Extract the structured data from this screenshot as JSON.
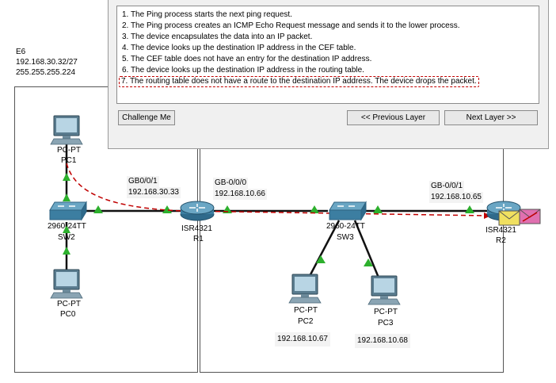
{
  "area_e6": {
    "name": "E6",
    "network": "192.168.30.32/27",
    "mask": "255.255.255.224"
  },
  "devices": {
    "pc1": {
      "type": "PC-PT",
      "name": "PC1"
    },
    "pc0": {
      "type": "PC-PT",
      "name": "PC0"
    },
    "sw2": {
      "model": "2960-24TT",
      "name": "SW2"
    },
    "r1": {
      "model": "ISR4321",
      "name": "R1"
    },
    "sw3": {
      "model": "2960-24TT",
      "name": "SW3"
    },
    "r2": {
      "model": "ISR4321",
      "name": "R2"
    },
    "pc2": {
      "type": "PC-PT",
      "name": "PC2",
      "ip": "192.168.10.67"
    },
    "pc3": {
      "type": "PC-PT",
      "name": "PC3",
      "ip": "192.168.10.68"
    }
  },
  "interfaces": {
    "r1_gb001": {
      "name": "GB0/0/1",
      "ip": "192.168.30.33"
    },
    "r1_gb000": {
      "name": "GB-0/0/0",
      "ip": "192.168.10.66"
    },
    "r2_gb001": {
      "name": "GB-0/0/1",
      "ip": "192.168.10.65"
    }
  },
  "pdu_panel": {
    "steps": [
      "1. The Ping process starts the next ping request.",
      "2. The Ping process creates an ICMP Echo Request message and sends it to the lower process.",
      "3. The device encapsulates the data into an IP packet.",
      "4. The device looks up the destination IP address in the CEF table.",
      "5. The CEF table does not have an entry for the destination IP address.",
      "6. The device looks up the destination IP address in the routing table.",
      "7. The routing table does not have a route to the destination IP address. The device drops the packet."
    ],
    "highlighted_step": 7,
    "challenge_label": "Challenge Me",
    "prev_label": "<< Previous Layer",
    "next_label": "Next Layer >>"
  },
  "colors": {
    "link": "#111111",
    "link_up": "#2db02d",
    "path": "#c00000",
    "envelope": "#f0e060",
    "envelope_x": "#e070b0"
  }
}
